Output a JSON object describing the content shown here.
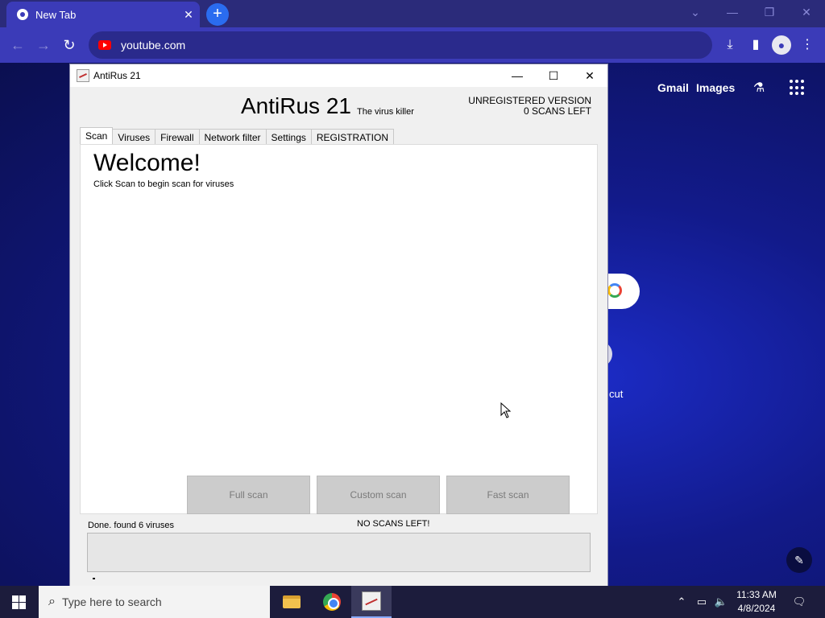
{
  "browser": {
    "tab_title": "New Tab",
    "tab_close": "✕",
    "new_tab": "+",
    "url": "youtube.com",
    "window_controls": {
      "minimize": "—",
      "restore": "❐",
      "close": "✕",
      "tab_search": "⌄"
    }
  },
  "newtab_page": {
    "gmail": "Gmail",
    "images": "Images",
    "shortcut_label": "cut"
  },
  "app": {
    "window_title": "AntiRus 21",
    "brand": "AntiRus 21",
    "tagline": "The virus killer",
    "unregistered": "UNREGISTERED VERSION",
    "scans_left": "0 SCANS LEFT",
    "tabs": [
      "Scan",
      "Viruses",
      "Firewall",
      "Network filter",
      "Settings",
      "REGISTRATION"
    ],
    "active_tab": "Scan",
    "welcome_title": "Welcome!",
    "welcome_sub": "Click Scan to begin scan for viruses",
    "buttons": {
      "full": "Full scan",
      "custom": "Custom scan",
      "fast": "Fast scan"
    },
    "status_left": "Done. found 6 viruses",
    "status_center": "NO SCANS LEFT!",
    "controls": {
      "minimize": "—",
      "maximize": "☐",
      "close": "✕"
    }
  },
  "taskbar": {
    "search_placeholder": "Type here to search",
    "time": "11:33 AM",
    "date": "4/8/2024"
  }
}
